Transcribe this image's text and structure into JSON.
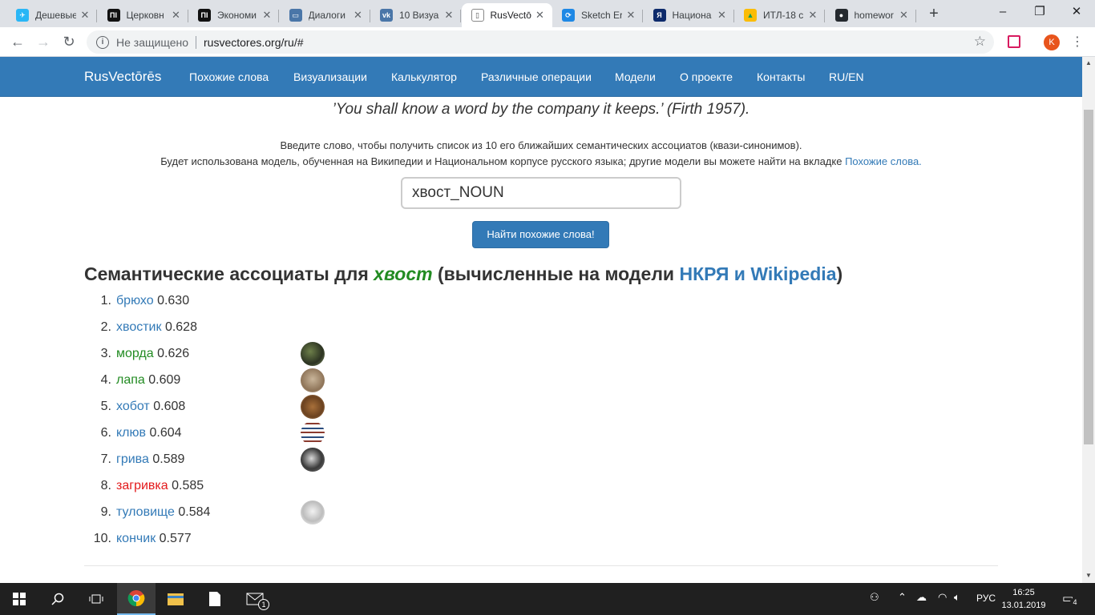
{
  "browser": {
    "tabs": [
      {
        "title": "Дешевые",
        "favicon_color": "#29b6f6",
        "favicon_glyph": "✈"
      },
      {
        "title": "Церковн",
        "favicon_color": "#111111",
        "favicon_glyph": "ПI"
      },
      {
        "title": "Экономи",
        "favicon_color": "#111111",
        "favicon_glyph": "ПI"
      },
      {
        "title": "Диалоги",
        "favicon_color": "#4a76a8",
        "favicon_glyph": "▭"
      },
      {
        "title": "10 Визуа",
        "favicon_color": "#4a76a8",
        "favicon_glyph": "vk"
      },
      {
        "title": "RusVectō",
        "favicon_color": "#ffffff",
        "favicon_glyph": "▯"
      },
      {
        "title": "Sketch Er",
        "favicon_color": "#1e88e5",
        "favicon_glyph": "⟳"
      },
      {
        "title": "Национа",
        "favicon_color": "#0d2a6b",
        "favicon_glyph": "Я"
      },
      {
        "title": "ИТЛ-18 с",
        "favicon_color": "#fbbc04",
        "favicon_glyph": "▲"
      },
      {
        "title": "homewor",
        "favicon_color": "#24292e",
        "favicon_glyph": "●"
      }
    ],
    "address": {
      "security_label": "Не защищено",
      "url": "rusvectores.org/ru/#"
    },
    "profile_initial": "K"
  },
  "navbar": {
    "brand": "RusVectōrēs",
    "links": [
      "Похожие слова",
      "Визуализации",
      "Калькулятор",
      "Различные операции",
      "Модели",
      "О проекте",
      "Контакты",
      "RU/EN"
    ]
  },
  "content": {
    "quote": "’You shall know a word by the company it keeps.’ (Firth 1957).",
    "intro_line1": "Введите слово, чтобы получить список из 10 его ближайших семантических ассоциатов (квази-синонимов).",
    "intro_line2": "Будет использована модель, обученная на Википедии и Национальном корпусе русского языка; другие модели вы можете найти на вкладке ",
    "intro_link": "Похожие слова.",
    "search_value": "хвост_NOUN",
    "find_button": "Найти похожие слова!",
    "heading_prefix": "Семантические ассоциаты для ",
    "heading_word": "хвост",
    "heading_middle": " (вычисленные на модели ",
    "heading_model": "НКРЯ и Wikipedia",
    "heading_suffix": ")"
  },
  "results": [
    {
      "n": "1.",
      "word": "брюхо",
      "score": "0.630",
      "color": "#337ab7",
      "img": null
    },
    {
      "n": "2.",
      "word": "хвостик",
      "score": "0.628",
      "color": "#337ab7",
      "img": null
    },
    {
      "n": "3.",
      "word": "морда",
      "score": "0.626",
      "color": "#228b22",
      "img": "radial-gradient(circle at 40% 40%, #6d7f4a, #2c3322 60%, #8a9a6a)"
    },
    {
      "n": "4.",
      "word": "лапа",
      "score": "0.609",
      "color": "#228b22",
      "img": "radial-gradient(circle at 50% 45%, #c9b59a, #8e7458 65%, #e0d2bf)"
    },
    {
      "n": "5.",
      "word": "хобот",
      "score": "0.608",
      "color": "#337ab7",
      "img": "radial-gradient(circle at 50% 50%, #a8703a, #6b4220 60%, #c89a68)"
    },
    {
      "n": "6.",
      "word": "клюв",
      "score": "0.604",
      "color": "#337ab7",
      "img": "repeating-linear-gradient(0deg, #ffffff 0 4px, #8b3a2e 4px 6px, #ffffff 6px 9px, #2b4c7e 9px 11px)"
    },
    {
      "n": "7.",
      "word": "грива",
      "score": "0.589",
      "color": "#337ab7",
      "img": "radial-gradient(circle at 45% 45%, #d9d9d9, #3a3a3a 55%, #7a7a7a)"
    },
    {
      "n": "8.",
      "word": "загривка",
      "score": "0.585",
      "color": "#e31a1c",
      "img": null
    },
    {
      "n": "9.",
      "word": "туловище",
      "score": "0.584",
      "color": "#337ab7",
      "img": "radial-gradient(circle at 50% 45%, #f2f2f2, #bdbdbd 55%, #ffffff)"
    },
    {
      "n": "10.",
      "word": "кончик",
      "score": "0.577",
      "color": "#337ab7",
      "img": null
    }
  ],
  "taskbar": {
    "language": "РУС",
    "time": "16:25",
    "date": "13.01.2019",
    "mail_badge": "1",
    "notification_count": "4"
  }
}
